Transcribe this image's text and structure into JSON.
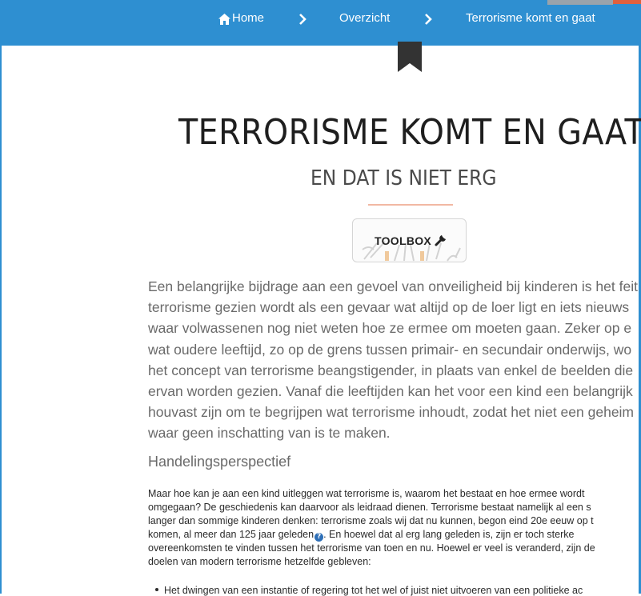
{
  "breadcrumb": {
    "home_label": "Home",
    "overview_label": "Overzicht",
    "current_label": "Terrorisme komt en gaat",
    "icons": [
      "home-icon",
      "chevron-right-icon",
      "bookmark-icon"
    ]
  },
  "article": {
    "title": "TERRORISME KOMT EN GAAT",
    "subtitle": "EN DAT IS NIET ERG",
    "toolbox_label": "TOOLBOX",
    "intro_lines": [
      "Een belangrijke bijdrage aan een gevoel van onveiligheid bij kinderen is het feit",
      "terrorisme gezien wordt als een gevaar wat altijd op de loer ligt en iets nieuws",
      "waar volwassenen nog niet weten hoe ze ermee om moeten gaan. Zeker op e",
      "wat oudere leeftijd, zo op de grens tussen primair- en secundair onderwijs, wo",
      "het concept van terrorisme beangstigender, in plaats van enkel de beelden die",
      "ervan worden gezien. Vanaf die leeftijden kan het voor een kind een belangrijk",
      "houvast zijn om te begrijpen wat terrorisme inhoudt, zodat het niet een geheim",
      "waar geen inschatting van is te maken."
    ],
    "section_heading": "Handelingsperspectief",
    "body_lines": [
      "Maar hoe kan je aan een kind uitleggen wat terrorisme is, waarom het bestaat en hoe ermee wordt",
      "omgegaan? De geschiedenis kan daarvoor als leidraad dienen. Terrorisme bestaat namelijk al een s",
      "langer dan sommige kinderen denken: terrorisme zoals wij dat nu kunnen, begon eind 20e eeuw op t",
      "komen, al meer dan 125 jaar geleden",
      ". En hoewel dat al erg lang geleden is, zijn er toch sterke",
      "overeenkomsten te vinden tussen het terrorisme van toen en nu. Hoewel er veel is veranderd, zijn de",
      "doelen van modern terrorisme hetzelfde gebleven:"
    ],
    "bullet_partial": "Het dwingen van een instantie of regering tot het wel of juist niet uitvoeren van een politieke ac"
  },
  "colors": {
    "topbar": "#2e8fd1",
    "accent_line": "#f2b8a3",
    "title_text": "#1e1e1e",
    "intro_text": "#6a6a6a"
  }
}
